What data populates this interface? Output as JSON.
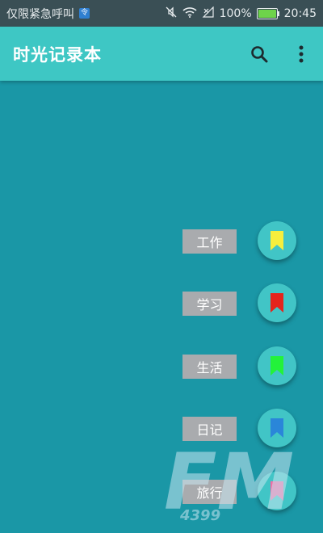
{
  "status_bar": {
    "left_text": "仅限紧急呼叫",
    "sim_badge": "令",
    "battery_percent": "100%",
    "battery_level": 1.0,
    "time": "20:45"
  },
  "app_bar": {
    "title": "时光记录本",
    "search_icon": "search-icon",
    "more_icon": "more-vert-icon"
  },
  "categories": [
    {
      "label": "工作",
      "bookmark_color": "#f6ee3d"
    },
    {
      "label": "学习",
      "bookmark_color": "#e5241c"
    },
    {
      "label": "生活",
      "bookmark_color": "#23f23a"
    },
    {
      "label": "日记",
      "bookmark_color": "#2a86d9"
    },
    {
      "label": "旅行",
      "bookmark_color": "#ee6fa6"
    }
  ],
  "watermark": {
    "text": "FM",
    "subtext": "4399"
  },
  "colors": {
    "background": "#1a97a6",
    "app_bar": "#3ec7c4",
    "status_bar": "#3a4f55",
    "label_bg": "#a9abae",
    "fab_bg": "#41c5c6"
  }
}
